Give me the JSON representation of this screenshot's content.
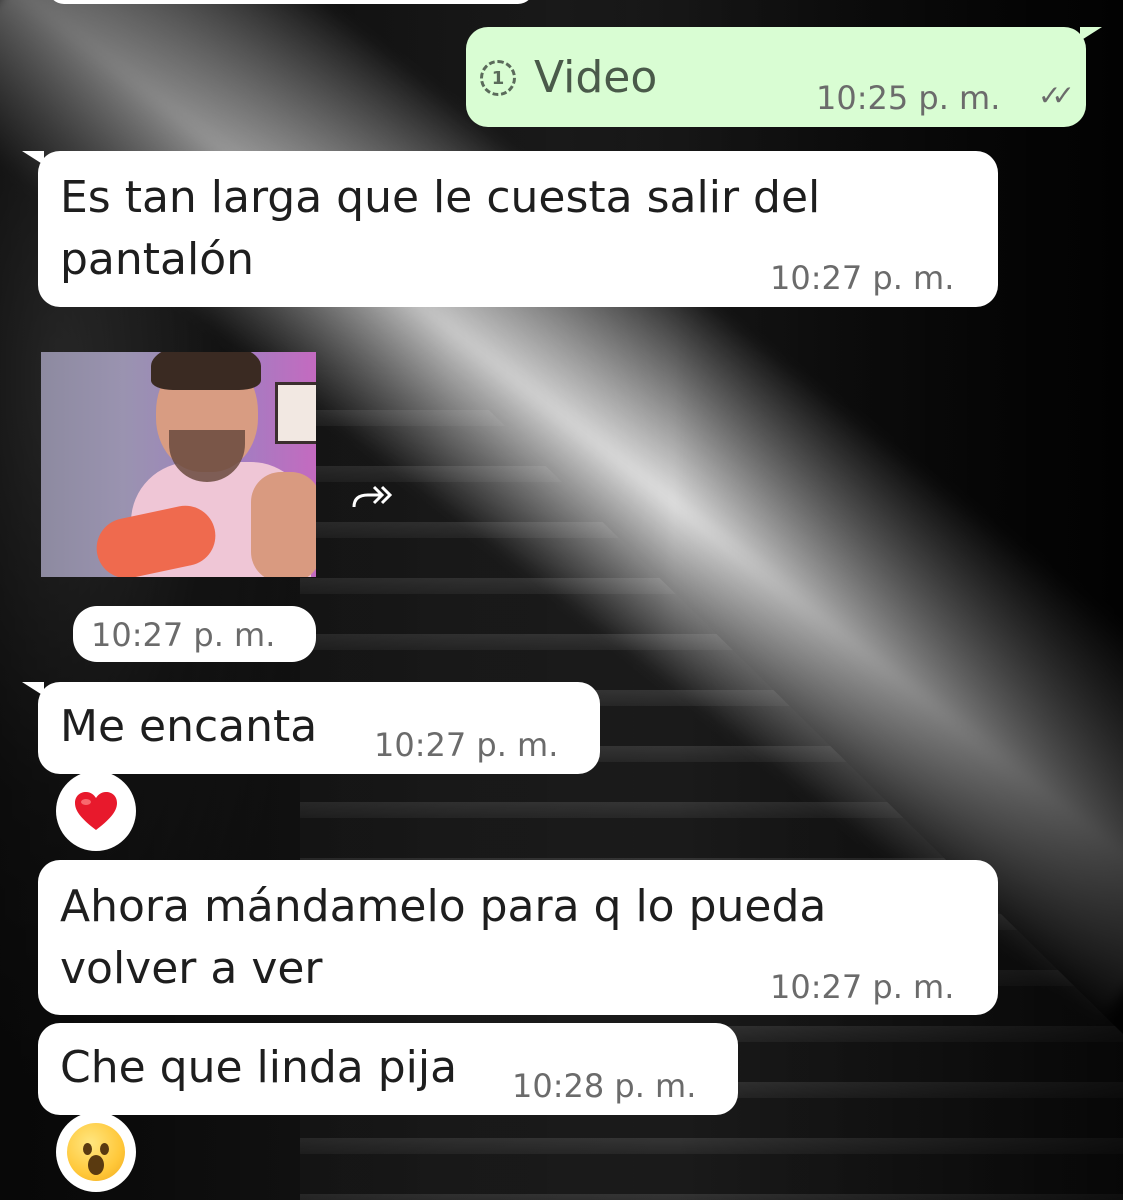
{
  "messages": [
    {
      "id": "m1",
      "direction": "outgoing",
      "type": "view_once_video",
      "label": "Video",
      "view_once_count": "1",
      "time": "10:25 p. m.",
      "status": "read"
    },
    {
      "id": "m2",
      "direction": "incoming",
      "lines": [
        "Es tan larga que le cuesta salir del",
        "pantalón"
      ],
      "time": "10:27 p. m."
    },
    {
      "id": "m3",
      "direction": "incoming",
      "type": "sticker",
      "time": "10:27 p. m."
    },
    {
      "id": "m4",
      "direction": "incoming",
      "lines": [
        "Me encanta"
      ],
      "time": "10:27 p. m.",
      "reaction": "❤️"
    },
    {
      "id": "m5",
      "direction": "incoming",
      "lines": [
        "Ahora mándamelo para q lo pueda",
        "volver a ver"
      ],
      "time": "10:27 p. m."
    },
    {
      "id": "m6",
      "direction": "incoming",
      "lines": [
        "Che que linda pija"
      ],
      "time": "10:28 p. m.",
      "reaction": "😮"
    }
  ],
  "icons": {
    "read_ticks": "double-check-icon",
    "view_once": "view-once-icon",
    "forward": "forward-icon"
  },
  "colors": {
    "outgoing_bubble": "#d9fdd3",
    "incoming_bubble": "#ffffff",
    "timestamp": "#6b6b6b",
    "text": "#1e1e1e"
  }
}
